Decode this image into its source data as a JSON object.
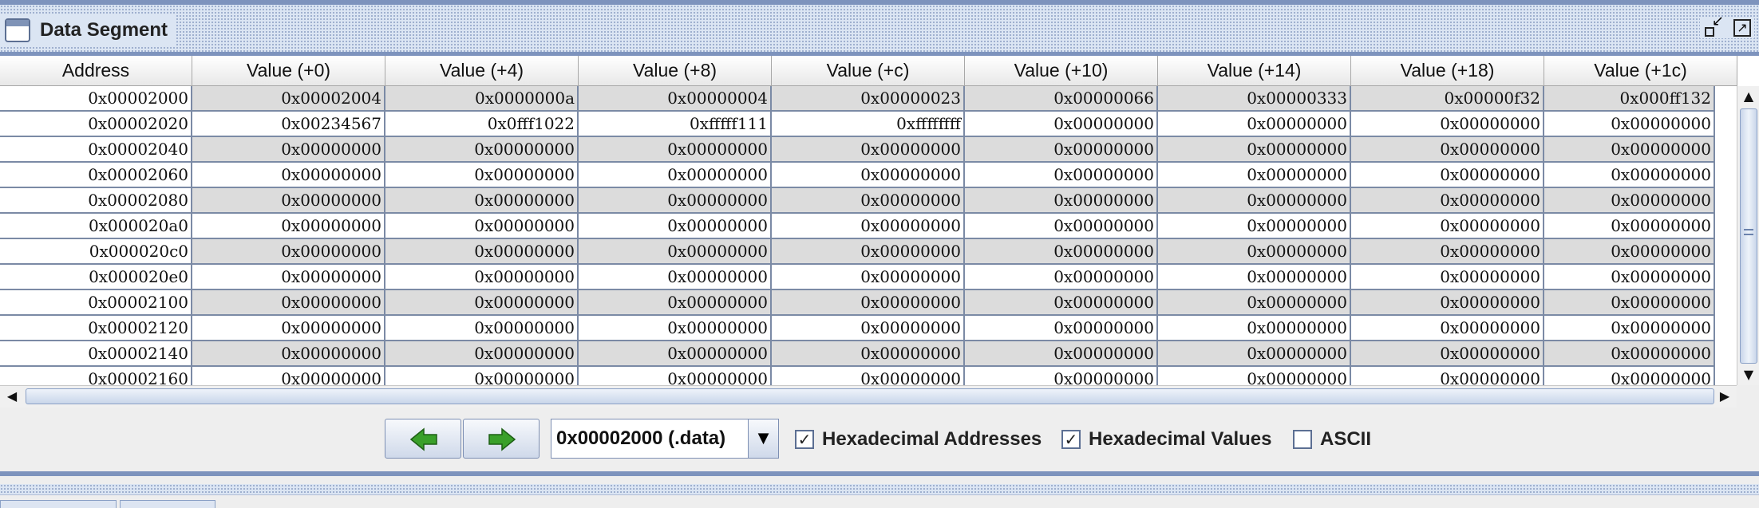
{
  "window": {
    "title": "Data Segment"
  },
  "columns": [
    "Address",
    "Value (+0)",
    "Value (+4)",
    "Value (+8)",
    "Value (+c)",
    "Value (+10)",
    "Value (+14)",
    "Value (+18)",
    "Value (+1c)"
  ],
  "rows": [
    [
      "0x00002000",
      "0x00002004",
      "0x0000000a",
      "0x00000004",
      "0x00000023",
      "0x00000066",
      "0x00000333",
      "0x00000f32",
      "0x000ff132"
    ],
    [
      "0x00002020",
      "0x00234567",
      "0x0fff1022",
      "0xfffff111",
      "0xffffffff",
      "0x00000000",
      "0x00000000",
      "0x00000000",
      "0x00000000"
    ],
    [
      "0x00002040",
      "0x00000000",
      "0x00000000",
      "0x00000000",
      "0x00000000",
      "0x00000000",
      "0x00000000",
      "0x00000000",
      "0x00000000"
    ],
    [
      "0x00002060",
      "0x00000000",
      "0x00000000",
      "0x00000000",
      "0x00000000",
      "0x00000000",
      "0x00000000",
      "0x00000000",
      "0x00000000"
    ],
    [
      "0x00002080",
      "0x00000000",
      "0x00000000",
      "0x00000000",
      "0x00000000",
      "0x00000000",
      "0x00000000",
      "0x00000000",
      "0x00000000"
    ],
    [
      "0x000020a0",
      "0x00000000",
      "0x00000000",
      "0x00000000",
      "0x00000000",
      "0x00000000",
      "0x00000000",
      "0x00000000",
      "0x00000000"
    ],
    [
      "0x000020c0",
      "0x00000000",
      "0x00000000",
      "0x00000000",
      "0x00000000",
      "0x00000000",
      "0x00000000",
      "0x00000000",
      "0x00000000"
    ],
    [
      "0x000020e0",
      "0x00000000",
      "0x00000000",
      "0x00000000",
      "0x00000000",
      "0x00000000",
      "0x00000000",
      "0x00000000",
      "0x00000000"
    ],
    [
      "0x00002100",
      "0x00000000",
      "0x00000000",
      "0x00000000",
      "0x00000000",
      "0x00000000",
      "0x00000000",
      "0x00000000",
      "0x00000000"
    ],
    [
      "0x00002120",
      "0x00000000",
      "0x00000000",
      "0x00000000",
      "0x00000000",
      "0x00000000",
      "0x00000000",
      "0x00000000",
      "0x00000000"
    ],
    [
      "0x00002140",
      "0x00000000",
      "0x00000000",
      "0x00000000",
      "0x00000000",
      "0x00000000",
      "0x00000000",
      "0x00000000",
      "0x00000000"
    ],
    [
      "0x00002160",
      "0x00000000",
      "0x00000000",
      "0x00000000",
      "0x00000000",
      "0x00000000",
      "0x00000000",
      "0x00000000",
      "0x00000000"
    ]
  ],
  "toolbar": {
    "prev_icon": "arrow-left-icon",
    "next_icon": "arrow-right-icon",
    "segment_select": "0x00002000 (.data)",
    "hex_addresses": {
      "label": "Hexadecimal Addresses",
      "checked": true
    },
    "hex_values": {
      "label": "Hexadecimal Values",
      "checked": true
    },
    "ascii": {
      "label": "ASCII",
      "checked": false
    }
  },
  "colors": {
    "accent": "#7d93bd",
    "row_alt": "#dcdcdc",
    "grid": "#7b8aa5",
    "arrow_green": "#3aa02a"
  }
}
